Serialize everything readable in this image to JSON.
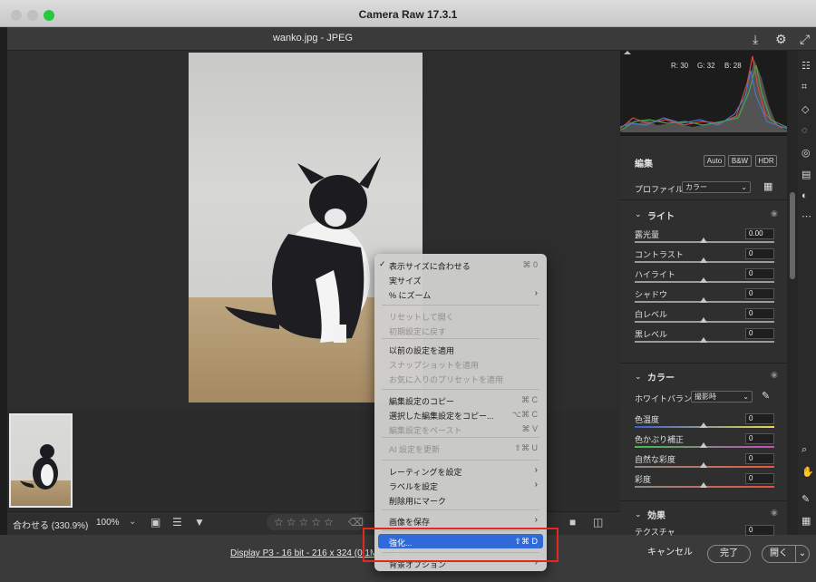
{
  "window": {
    "title": "Camera Raw 17.3.1"
  },
  "file": {
    "title": "wanko.jpg  -  JPEG",
    "save_icon": "download-icon",
    "settings_icon": "gear-icon",
    "fullscreen_icon": "expand-icon"
  },
  "histogram": {
    "r": "R: 30",
    "g": "G: 32",
    "b": "B: 28"
  },
  "edit": {
    "title": "編集",
    "auto": "Auto",
    "bw": "B&W",
    "hdr": "HDR",
    "profile_label": "プロファイル",
    "profile_value": "カラー"
  },
  "light": {
    "title": "ライト",
    "sliders": [
      {
        "label": "露光量",
        "value": "0.00"
      },
      {
        "label": "コントラスト",
        "value": "0"
      },
      {
        "label": "ハイライト",
        "value": "0"
      },
      {
        "label": "シャドウ",
        "value": "0"
      },
      {
        "label": "白レベル",
        "value": "0"
      },
      {
        "label": "黒レベル",
        "value": "0"
      }
    ]
  },
  "color": {
    "title": "カラー",
    "wb_label": "ホワイトバランス",
    "wb_value": "撮影時",
    "sliders": [
      {
        "label": "色温度",
        "value": "0"
      },
      {
        "label": "色かぶり補正",
        "value": "0"
      },
      {
        "label": "自然な彩度",
        "value": "0"
      },
      {
        "label": "彩度",
        "value": "0"
      }
    ]
  },
  "effects": {
    "title": "効果",
    "texture_label": "テクスチャ",
    "texture_value": "0"
  },
  "bottombar": {
    "zoom_fit": "合わせる (330.9%)",
    "zoom_100": "100%",
    "stars": "☆☆☆☆☆"
  },
  "footer": {
    "display_info": "Display P3 - 16 bit - 216 x 324 (0.1MP) - 3",
    "cancel": "キャンセル",
    "done": "完了",
    "open": "開く"
  },
  "menu": {
    "items": [
      {
        "label": "表示サイズに合わせる",
        "shortcut": "⌘ 0",
        "checked": true
      },
      {
        "label": "実サイズ",
        "shortcut": ""
      },
      {
        "label": "% にズーム",
        "shortcut": "",
        "submenu": true
      },
      {
        "label": "リセットして開く",
        "shortcut": "",
        "disabled": true
      },
      {
        "label": "初期設定に戻す",
        "shortcut": "",
        "disabled": true
      },
      {
        "label": "以前の設定を適用",
        "shortcut": ""
      },
      {
        "label": "スナップショットを適用",
        "shortcut": "",
        "disabled": true
      },
      {
        "label": "お気に入りのプリセットを適用",
        "shortcut": "",
        "disabled": true
      },
      {
        "label": "編集設定のコピー",
        "shortcut": "⌘ C"
      },
      {
        "label": "選択した編集設定をコピー...",
        "shortcut": "⌥⌘ C"
      },
      {
        "label": "編集設定をペースト",
        "shortcut": "⌘ V",
        "disabled": true
      },
      {
        "label": "AI 設定を更新",
        "shortcut": "⇧⌘ U",
        "disabled": true
      },
      {
        "label": "レーティングを設定",
        "shortcut": "",
        "submenu": true
      },
      {
        "label": "ラベルを設定",
        "shortcut": "",
        "submenu": true
      },
      {
        "label": "削除用にマーク",
        "shortcut": ""
      },
      {
        "label": "画像を保存",
        "shortcut": "",
        "submenu": true
      },
      {
        "label": "強化...",
        "shortcut": "⇧⌘ D",
        "highlighted": true
      },
      {
        "label": "背景オプション",
        "shortcut": "",
        "submenu": true
      }
    ]
  },
  "colors": {
    "highlight": "#2f6ad8",
    "annotation": "#e0291f",
    "done_border": "#8a8a8a"
  }
}
